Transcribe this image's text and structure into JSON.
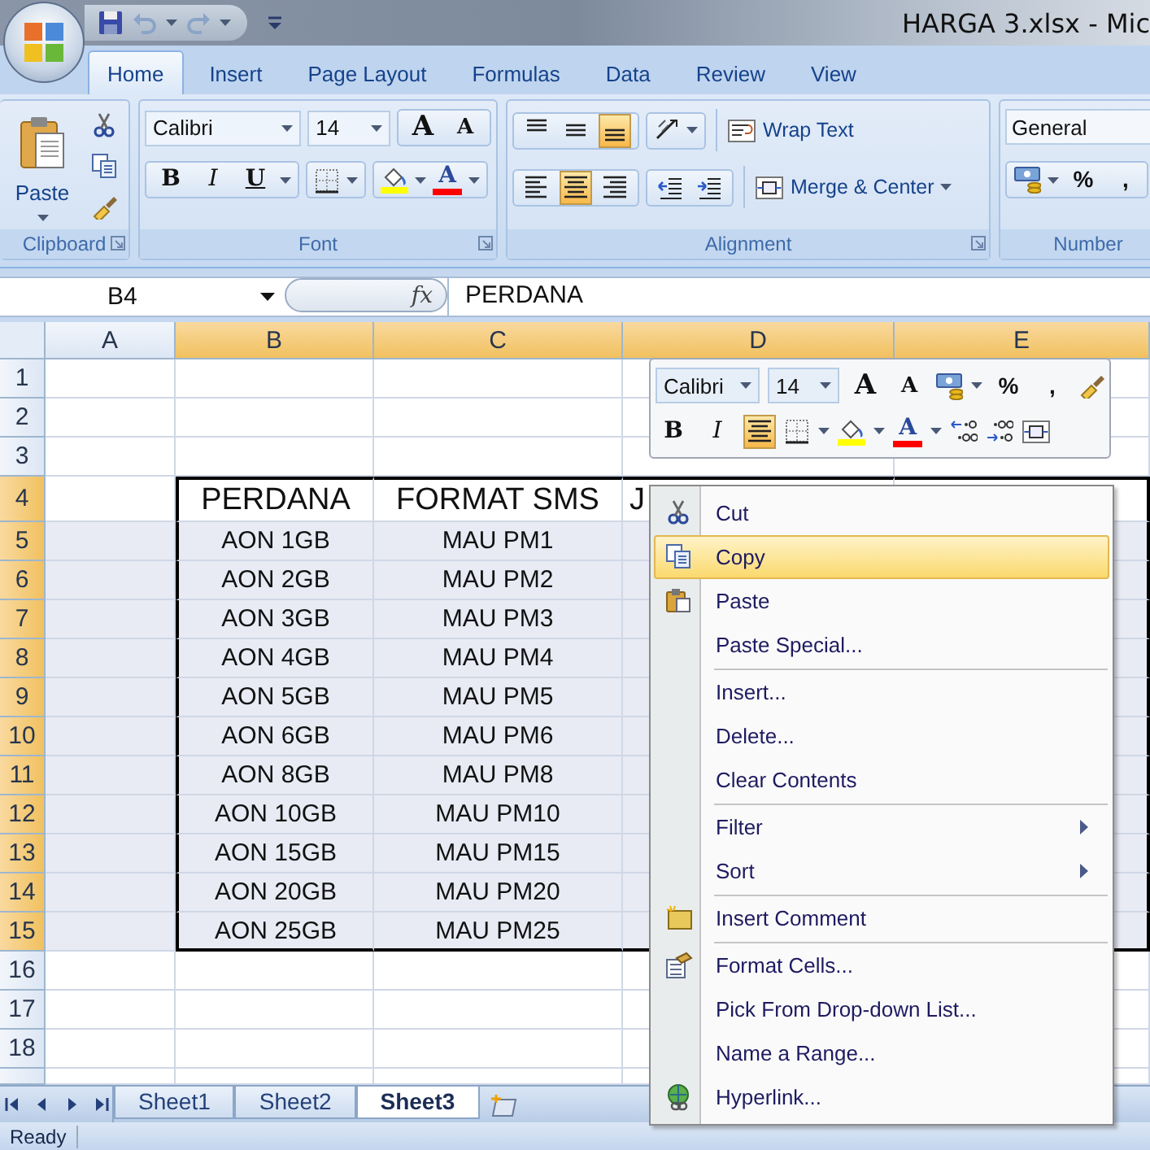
{
  "window": {
    "title": "HARGA 3.xlsx - Mic"
  },
  "ribbon_tabs": [
    {
      "label": "Home",
      "selected": true
    },
    {
      "label": "Insert",
      "selected": false
    },
    {
      "label": "Page Layout",
      "selected": false
    },
    {
      "label": "Formulas",
      "selected": false
    },
    {
      "label": "Data",
      "selected": false
    },
    {
      "label": "Review",
      "selected": false
    },
    {
      "label": "View",
      "selected": false
    }
  ],
  "clipboard": {
    "paste": "Paste",
    "group_label": "Clipboard"
  },
  "font": {
    "name": "Calibri",
    "size": "14",
    "grow": "A",
    "shrink": "A",
    "styles": [
      {
        "kind": "bold",
        "label": "B"
      },
      {
        "kind": "italic",
        "label": "I"
      },
      {
        "kind": "underline",
        "label": "U"
      }
    ],
    "font_color": "A",
    "group_label": "Font"
  },
  "alignment": {
    "vertical": [
      {
        "kind": "top",
        "selected": false
      },
      {
        "kind": "middle",
        "selected": false
      },
      {
        "kind": "bottom",
        "selected": true
      }
    ],
    "horizontal": [
      {
        "kind": "left",
        "selected": false
      },
      {
        "kind": "center",
        "selected": true
      },
      {
        "kind": "right",
        "selected": false
      }
    ],
    "wrap_text": "Wrap Text",
    "merge_center": "Merge & Center",
    "group_label": "Alignment"
  },
  "number": {
    "format": "General",
    "percent": "%",
    "comma": ",",
    "group_label": "Number"
  },
  "formula_bar": {
    "name_box": "B4",
    "function_label": "fx",
    "value": "PERDANA"
  },
  "sheet": {
    "columns": [
      {
        "label": "A",
        "selected": false
      },
      {
        "label": "B",
        "selected": true
      },
      {
        "label": "C",
        "selected": true
      },
      {
        "label": "D",
        "selected": true
      },
      {
        "label": "E",
        "selected": true
      }
    ],
    "rows": [
      {
        "label": "1",
        "selected": false
      },
      {
        "label": "2",
        "selected": false
      },
      {
        "label": "3",
        "selected": false
      },
      {
        "label": "4",
        "selected": true,
        "kind": "header",
        "cells": [
          "PERDANA",
          "FORMAT SMS",
          "J"
        ]
      },
      {
        "label": "5",
        "selected": true,
        "kind": "data",
        "cells": [
          "AON 1GB",
          "MAU PM1"
        ]
      },
      {
        "label": "6",
        "selected": true,
        "kind": "data",
        "cells": [
          "AON 2GB",
          "MAU PM2"
        ]
      },
      {
        "label": "7",
        "selected": true,
        "kind": "data",
        "cells": [
          "AON 3GB",
          "MAU PM3"
        ]
      },
      {
        "label": "8",
        "selected": true,
        "kind": "data",
        "cells": [
          "AON 4GB",
          "MAU PM4"
        ]
      },
      {
        "label": "9",
        "selected": true,
        "kind": "data",
        "cells": [
          "AON 5GB",
          "MAU PM5"
        ]
      },
      {
        "label": "10",
        "selected": true,
        "kind": "data",
        "cells": [
          "AON 6GB",
          "MAU PM6"
        ]
      },
      {
        "label": "11",
        "selected": true,
        "kind": "data",
        "cells": [
          "AON 8GB",
          "MAU PM8"
        ]
      },
      {
        "label": "12",
        "selected": true,
        "kind": "data",
        "cells": [
          "AON 10GB",
          "MAU PM10"
        ]
      },
      {
        "label": "13",
        "selected": true,
        "kind": "data",
        "cells": [
          "AON 15GB",
          "MAU PM15"
        ]
      },
      {
        "label": "14",
        "selected": true,
        "kind": "data",
        "cells": [
          "AON 20GB",
          "MAU PM20"
        ]
      },
      {
        "label": "15",
        "selected": true,
        "kind": "data",
        "cells": [
          "AON 25GB",
          "MAU PM25"
        ]
      },
      {
        "label": "16",
        "selected": false
      },
      {
        "label": "17",
        "selected": false
      },
      {
        "label": "18",
        "selected": false
      }
    ]
  },
  "mini_toolbar": {
    "font_name": "Calibri",
    "font_size": "14",
    "grow": "A",
    "shrink": "A",
    "percent": "%",
    "comma": ",",
    "bold": "B",
    "italic": "I",
    "center": {
      "selected": true
    },
    "font_color": "A"
  },
  "context_menu": [
    {
      "kind": "cut",
      "label": "Cut",
      "selected": false,
      "submenu": false,
      "separator_before": false
    },
    {
      "kind": "copy",
      "label": "Copy",
      "selected": true,
      "submenu": false,
      "separator_before": false
    },
    {
      "kind": "paste",
      "label": "Paste",
      "selected": false,
      "submenu": false,
      "separator_before": false
    },
    {
      "kind": "plain",
      "label": "Paste Special...",
      "selected": false,
      "submenu": false,
      "separator_before": false
    },
    {
      "kind": "plain",
      "label": "Insert...",
      "selected": false,
      "submenu": false,
      "separator_before": true
    },
    {
      "kind": "plain",
      "label": "Delete...",
      "selected": false,
      "submenu": false,
      "separator_before": false
    },
    {
      "kind": "plain",
      "label": "Clear Contents",
      "selected": false,
      "submenu": false,
      "separator_before": false
    },
    {
      "kind": "plain",
      "label": "Filter",
      "selected": false,
      "submenu": true,
      "separator_before": true
    },
    {
      "kind": "plain",
      "label": "Sort",
      "selected": false,
      "submenu": true,
      "separator_before": false
    },
    {
      "kind": "comment",
      "label": "Insert Comment",
      "selected": false,
      "submenu": false,
      "separator_before": true
    },
    {
      "kind": "format",
      "label": "Format Cells...",
      "selected": false,
      "submenu": false,
      "separator_before": true
    },
    {
      "kind": "plain",
      "label": "Pick From Drop-down List...",
      "selected": false,
      "submenu": false,
      "separator_before": false
    },
    {
      "kind": "plain",
      "label": "Name a Range...",
      "selected": false,
      "submenu": false,
      "separator_before": false
    },
    {
      "kind": "link",
      "label": "Hyperlink...",
      "selected": false,
      "submenu": false,
      "separator_before": false
    }
  ],
  "sheet_tabs": [
    {
      "label": "Sheet1",
      "selected": false
    },
    {
      "label": "Sheet2",
      "selected": false
    },
    {
      "label": "Sheet3",
      "selected": true
    }
  ],
  "status_bar": {
    "text": "Ready"
  }
}
